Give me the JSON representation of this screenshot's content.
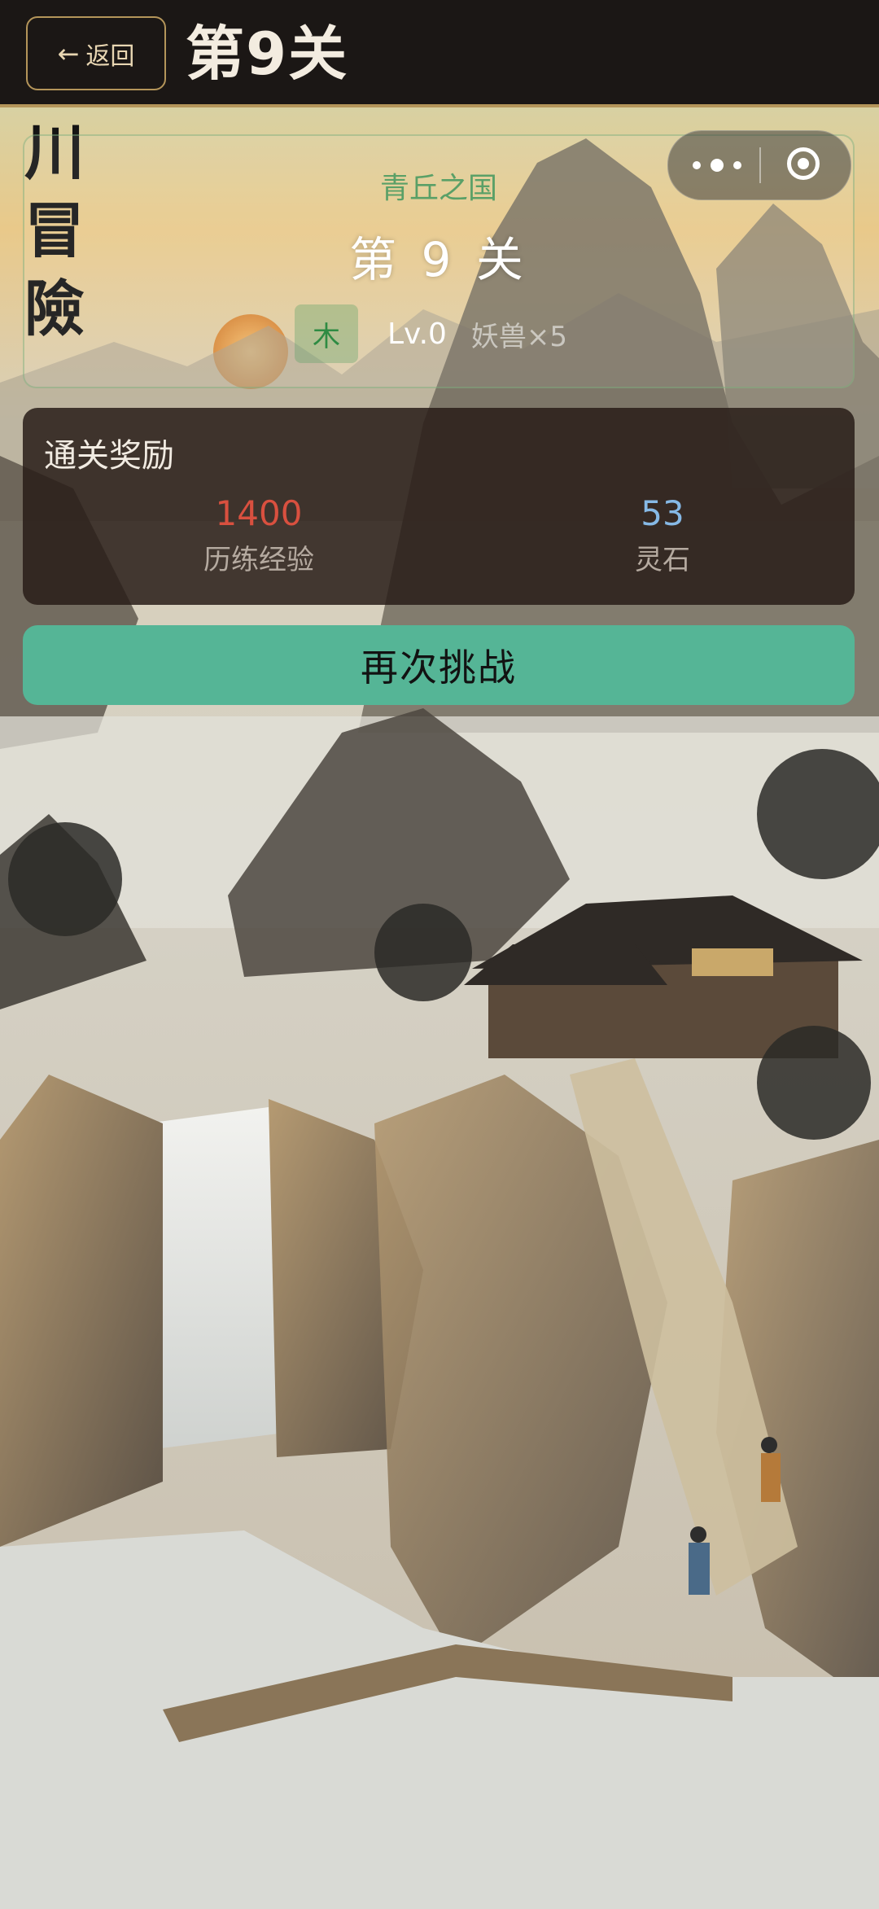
{
  "header": {
    "back_label": "返回",
    "title": "第9关"
  },
  "calligraphy": [
    "川",
    "冒",
    "險"
  ],
  "level": {
    "region": "青丘之国",
    "title": "第 9 关",
    "element": "木",
    "level_text": "Lv.0",
    "extra_text": "妖兽×5"
  },
  "rewards": {
    "title": "通关奖励",
    "exp_value": "1400",
    "exp_label": "历练经验",
    "stone_value": "53",
    "stone_label": "灵石"
  },
  "retry_label": "再次挑战",
  "colors": {
    "header_bg": "#1b1715",
    "accent_gold": "#b4955a",
    "element_green": "#5aa067",
    "exp_red": "#d9503f",
    "stone_blue": "#86b9e6",
    "retry_green": "#55b596"
  }
}
